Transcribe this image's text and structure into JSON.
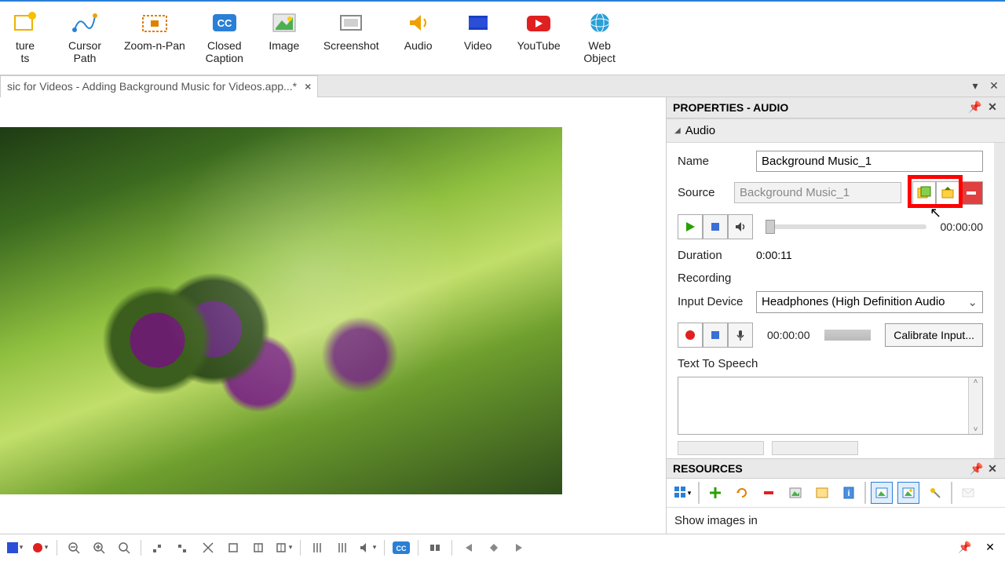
{
  "ribbon": {
    "items": [
      {
        "label": "ture\nts"
      },
      {
        "label": "Cursor\nPath"
      },
      {
        "label": "Zoom-n-Pan"
      },
      {
        "label": "Closed\nCaption"
      },
      {
        "label": "Image"
      },
      {
        "label": "Screenshot"
      },
      {
        "label": "Audio"
      },
      {
        "label": "Video"
      },
      {
        "label": "YouTube"
      },
      {
        "label": "Web\nObject"
      }
    ]
  },
  "tab": {
    "title": "sic for Videos - Adding Background Music for Videos.app...*",
    "close": "×"
  },
  "properties": {
    "title": "PROPERTIES - AUDIO",
    "section": "Audio",
    "name_label": "Name",
    "name_value": "Background Music_1",
    "source_label": "Source",
    "source_value": "Background Music_1",
    "play_time": "00:00:00",
    "duration_label": "Duration",
    "duration_value": "0:00:11",
    "recording_label": "Recording",
    "inputdev_label": "Input Device",
    "inputdev_value": "Headphones (High Definition Audio",
    "rec_time": "00:00:00",
    "calibrate_label": "Calibrate Input...",
    "tts_label": "Text To Speech"
  },
  "resources": {
    "title": "RESOURCES",
    "show_label": "Show images in"
  }
}
